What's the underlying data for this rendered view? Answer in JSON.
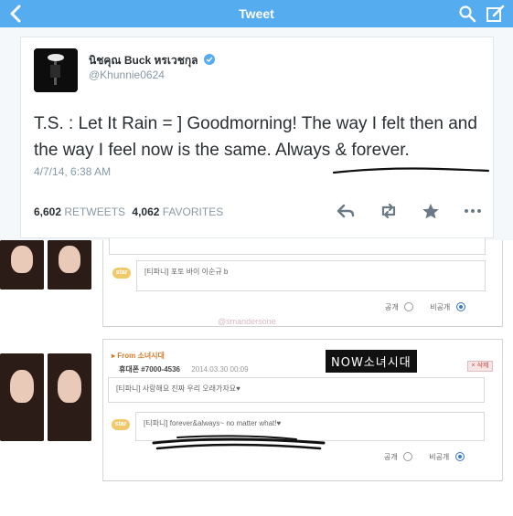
{
  "twitter": {
    "nav_title": "Tweet",
    "display_name": "นิชคุณ Buck หรเวชกุล",
    "handle": "@Khunnie0624",
    "tweet_text": "T.S. : Let It Rain = ] Goodmorning! The way I felt then and the way I feel now is the same. Always & forever.",
    "timestamp": "4/7/14, 6:38 AM",
    "retweets_count": "6,602",
    "retweets_label": "RETWEETS",
    "favorites_count": "4,062",
    "favorites_label": "FAVORITES",
    "icons": [
      "back-arrow-icon",
      "search-icon",
      "compose-icon",
      "verified-badge-icon",
      "reply-icon",
      "retweet-icon",
      "favorite-star-icon",
      "more-icon"
    ],
    "colors": {
      "nav": "#55acee",
      "text": "#292f33",
      "meta": "#8899a6"
    }
  },
  "korean_page": {
    "top_reply": {
      "badge": "star",
      "text": "[티파니] 포토 바이 이순규 b",
      "public_label": "공개",
      "private_label": "비공개"
    },
    "watermark": "@smandersone",
    "post": {
      "from_label": "▸ From 소녀시대",
      "phone": "휴대폰 #7000-4536",
      "date": "2014.03.30 00:09",
      "delete_label": "× 삭제",
      "sticker_text": "NOW소녀시대",
      "message": "[티파니] 사랑해요 진짜 우리 오래가자요♥",
      "reply_badge": "star",
      "reply_text": "[티파니] forever&always~ no matter what!♥",
      "public_label": "공개",
      "private_label": "비공개"
    }
  }
}
